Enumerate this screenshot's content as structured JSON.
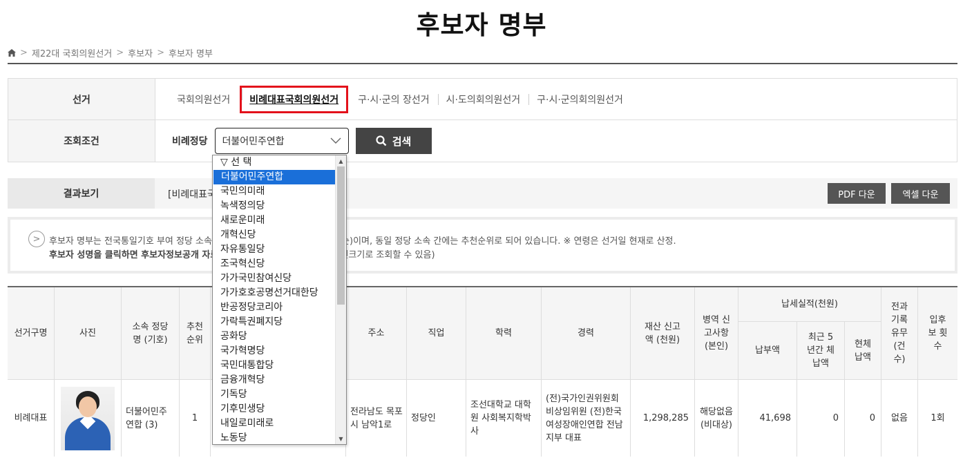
{
  "page": {
    "title": "후보자 명부"
  },
  "breadcrumb": {
    "items": [
      "제22대 국회의원선거",
      "후보자",
      "후보자 명부"
    ],
    "sep": ">"
  },
  "filter": {
    "election_label": "선거",
    "election_tabs": [
      "국회의원선거",
      "비례대표국회의원선거",
      "구·시·군의 장선거",
      "시·도의회의원선거",
      "구·시·군의회의원선거"
    ],
    "selected_tab": "비례대표국회의원선거",
    "condition_label": "조회조건",
    "party_label": "비례정당",
    "party_value": "더불어민주연합",
    "search_button": "검색"
  },
  "result": {
    "label": "결과보기",
    "text": "[비례대표국",
    "pdf_button": "PDF 다운",
    "excel_button": "엑셀 다운"
  },
  "notice": {
    "line1a": "후보자 명부는 전국통일기호 부여 정당 소속",
    "line1b": "의 가나다 순)이며, 동일 정당 소속 간에는 추천순위로 되어 있습니다. ※ 연령은 선거일 현재로 산정.",
    "line2a": "후보자 성명을 클릭하면 후보자정보공개 자료",
    "line2b": "시 실제 사진크기로 조회할 수 있음)"
  },
  "table": {
    "headers": {
      "district": "선거구명",
      "photo": "사진",
      "party": "소속 정당명 (기호)",
      "rank": "추천 순위",
      "address": "주소",
      "job": "직업",
      "education": "학력",
      "career": "경력",
      "assets": "재산 신고액 (천원)",
      "military": "병역 신고사항 (본인)",
      "tax_group": "납세실적(천원)",
      "tax_paid": "납부액",
      "tax_arrears5": "최근 5년간 체납액",
      "tax_current": "현체 납액",
      "criminal": "전과 기록 유무 (건수)",
      "candidacy": "입후보 횟수"
    },
    "rows": [
      {
        "district": "비례대표",
        "party": "더불어민주연합 (3)",
        "rank": "1",
        "address": "전라남도 목포시 남악1로",
        "job": "정당인",
        "education": "조선대학교 대학원 사회복지학박사",
        "career": "(전)국가인권위원회 비상임위원 (전)한국여성장애인연합 전남지부 대표",
        "assets": "1,298,285",
        "military": "해당없음 (비대상)",
        "tax_paid": "41,698",
        "tax_arrears5": "0",
        "tax_current": "0",
        "criminal": "없음",
        "candidacy": "1회"
      }
    ]
  },
  "dropdown": {
    "options": [
      "▽ 선 택",
      "더불어민주연합",
      "국민의미래",
      "녹색정의당",
      "새로운미래",
      "개혁신당",
      "자유통일당",
      "조국혁신당",
      "가가국민참여신당",
      "가가호호공명선거대한당",
      "반공정당코리아",
      "가락특권폐지당",
      "공화당",
      "국가혁명당",
      "국민대통합당",
      "금융개혁당",
      "기독당",
      "기후민생당",
      "내일로미래로",
      "노동당"
    ],
    "highlighted": "더불어민주연합"
  },
  "colors": {
    "highlight_border": "#e3111b",
    "selection": "#1a6fd9",
    "button": "#444444"
  }
}
